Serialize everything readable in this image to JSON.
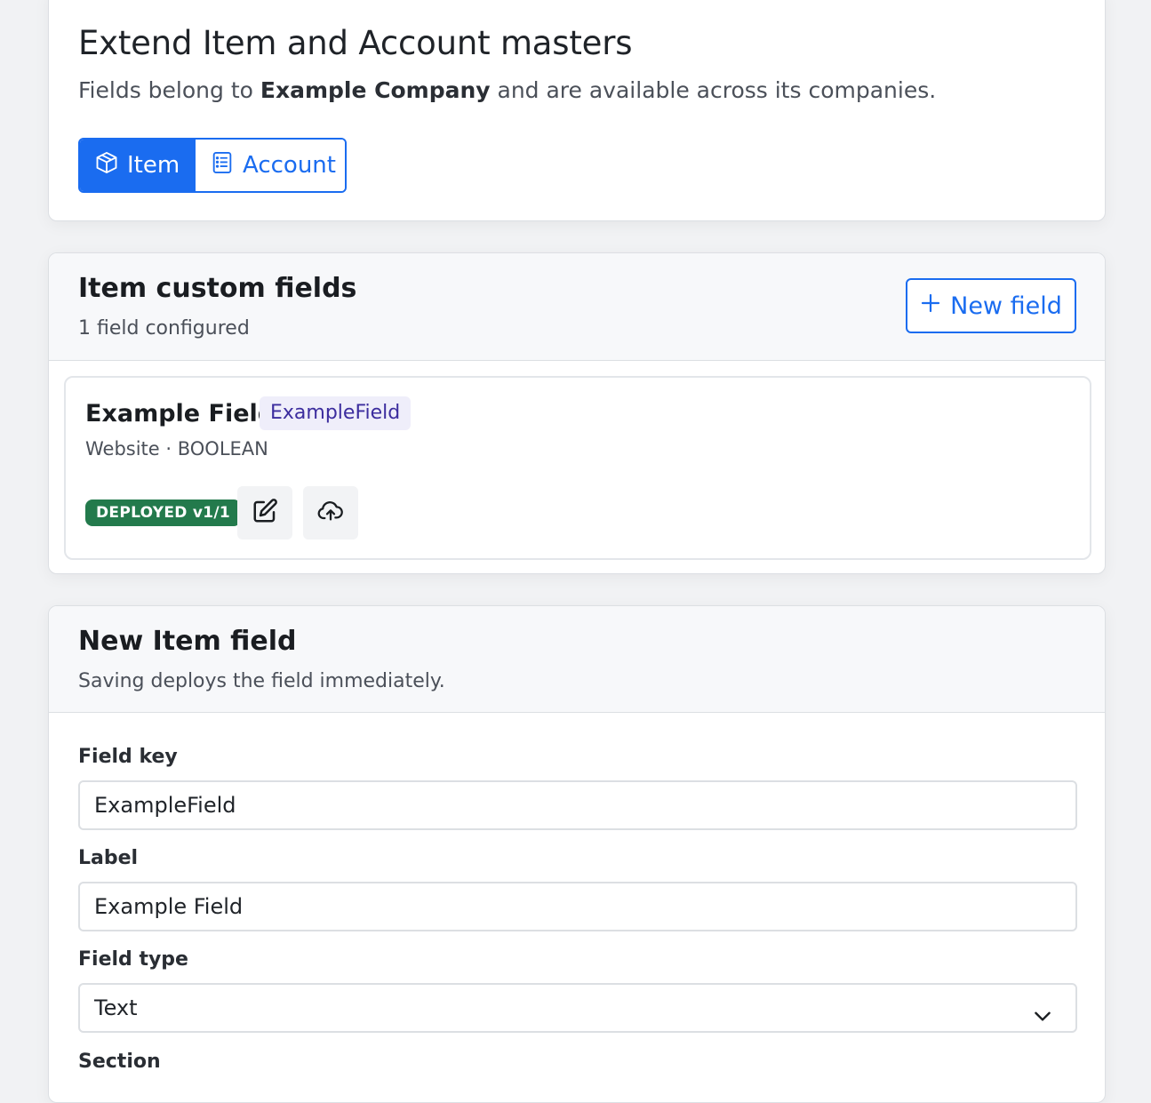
{
  "intro": {
    "title": "Extend Item and Account masters",
    "subtitle_prefix": "Fields belong to ",
    "company": "Example Company",
    "subtitle_suffix": " and are available across its companies.",
    "tabs": [
      {
        "label": "Item",
        "icon": "cube-icon",
        "active": true
      },
      {
        "label": "Account",
        "icon": "list-icon",
        "active": false
      }
    ]
  },
  "fields_card": {
    "title": "Item custom fields",
    "count_text": "1 field configured",
    "new_field_label": "New field",
    "items": [
      {
        "name": "Example Field",
        "key": "ExampleField",
        "meta": "Website · BOOLEAN",
        "status": "DEPLOYED v1/1"
      }
    ]
  },
  "new_field_form": {
    "title": "New Item field",
    "subtitle": "Saving deploys the field immediately.",
    "field_key_label": "Field key",
    "field_key_value": "ExampleField",
    "label_label": "Label",
    "label_value": "Example Field",
    "field_type_label": "Field type",
    "field_type_value": "Text",
    "section_label": "Section"
  },
  "colors": {
    "accent": "#1a6cf0",
    "deployed": "#237a4c",
    "key_chip_bg": "#efeefa",
    "key_chip_text": "#3c2d9e"
  }
}
